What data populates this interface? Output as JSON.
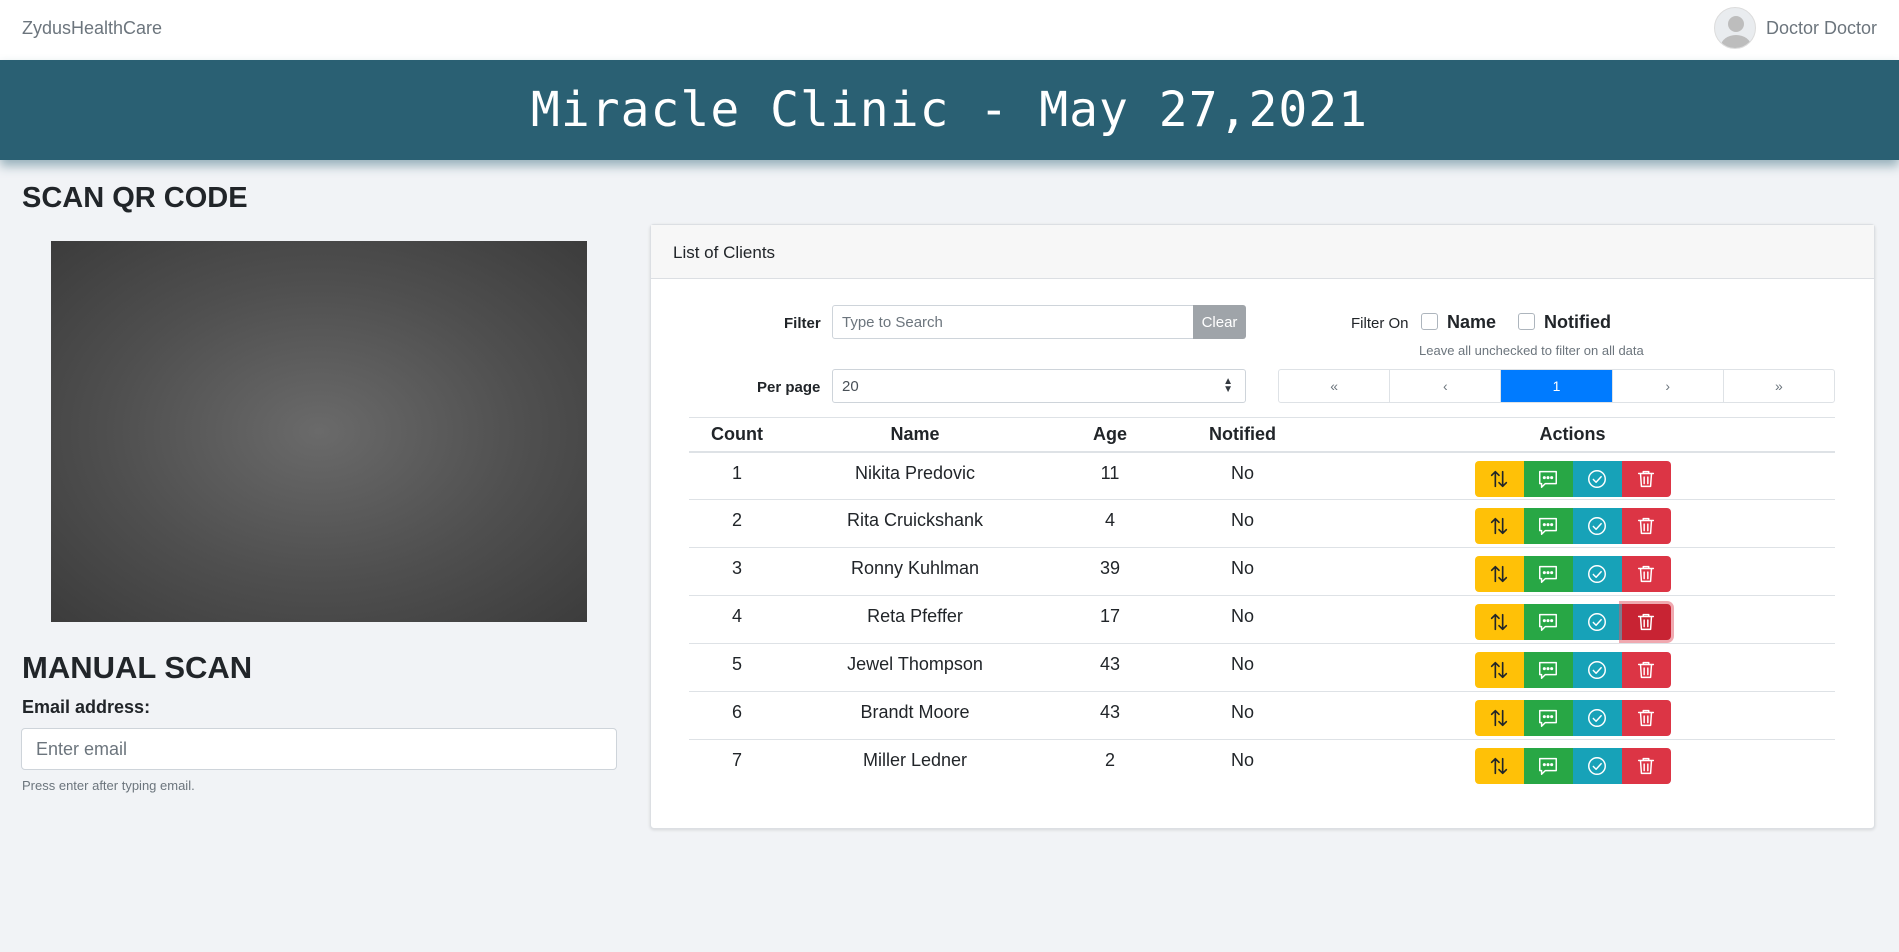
{
  "navbar": {
    "brand": "ZydusHealthCare",
    "username": "Doctor Doctor"
  },
  "banner": {
    "title": "Miracle Clinic - May 27,2021"
  },
  "scan": {
    "title": "SCAN QR CODE"
  },
  "manual": {
    "title": "MANUAL SCAN",
    "email_label": "Email address:",
    "email_placeholder": "Enter email",
    "email_help": "Press enter after typing email."
  },
  "clients": {
    "header": "List of Clients",
    "filter_label": "Filter",
    "filter_placeholder": "Type to Search",
    "clear_label": "Clear",
    "filter_on_label": "Filter On",
    "filter_name_label": "Name",
    "filter_notified_label": "Notified",
    "filter_help": "Leave all unchecked to filter on all data",
    "per_page_label": "Per page",
    "per_page_value": "20",
    "pagination": {
      "first": "«",
      "prev": "‹",
      "current": "1",
      "next": "›",
      "last": "»"
    },
    "columns": {
      "count": "Count",
      "name": "Name",
      "age": "Age",
      "notified": "Notified",
      "actions": "Actions"
    },
    "rows": [
      {
        "count": "1",
        "name": "Nikita Predovic",
        "age": "11",
        "notified": "No"
      },
      {
        "count": "2",
        "name": "Rita Cruickshank",
        "age": "4",
        "notified": "No"
      },
      {
        "count": "3",
        "name": "Ronny Kuhlman",
        "age": "39",
        "notified": "No"
      },
      {
        "count": "4",
        "name": "Reta Pfeffer",
        "age": "17",
        "notified": "No"
      },
      {
        "count": "5",
        "name": "Jewel Thompson",
        "age": "43",
        "notified": "No"
      },
      {
        "count": "6",
        "name": "Brandt Moore",
        "age": "43",
        "notified": "No"
      },
      {
        "count": "7",
        "name": "Miller Ledner",
        "age": "2",
        "notified": "No"
      }
    ],
    "action_icons": [
      "sort-icon",
      "message-icon",
      "check-circle-icon",
      "trash-icon"
    ]
  },
  "colors": {
    "banner": "#2a6073",
    "warning": "#ffc107",
    "success": "#28a745",
    "info": "#17a2b8",
    "danger": "#dc3545",
    "primary": "#007bff"
  }
}
